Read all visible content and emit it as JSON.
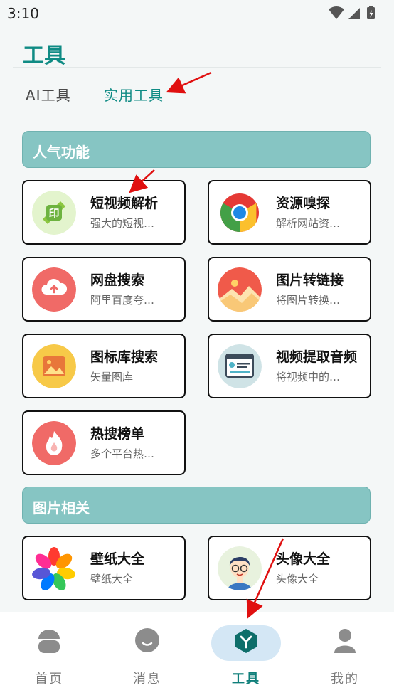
{
  "status": {
    "time": "3:10"
  },
  "header": {
    "title": "工具"
  },
  "tabs": [
    {
      "label": "AI工具"
    },
    {
      "label": "实用工具"
    }
  ],
  "sections": [
    {
      "title": "人气功能",
      "cards": [
        {
          "title": "短视频解析",
          "subtitle": "强大的短视…",
          "icon": "video-parse-icon"
        },
        {
          "title": "资源嗅探",
          "subtitle": "解析网站资…",
          "icon": "chrome-icon"
        },
        {
          "title": "网盘搜索",
          "subtitle": "阿里百度夸…",
          "icon": "cloud-upload-icon"
        },
        {
          "title": "图片转链接",
          "subtitle": "将图片转换…",
          "icon": "image-link-icon"
        },
        {
          "title": "图标库搜索",
          "subtitle": "矢量图库",
          "icon": "icon-library-icon"
        },
        {
          "title": "视频提取音频",
          "subtitle": "将视频中的…",
          "icon": "video-audio-icon"
        },
        {
          "title": "热搜榜单",
          "subtitle": "多个平台热…",
          "icon": "flame-icon"
        }
      ]
    },
    {
      "title": "图片相关",
      "cards": [
        {
          "title": "壁纸大全",
          "subtitle": "壁纸大全",
          "icon": "flower-icon"
        },
        {
          "title": "头像大全",
          "subtitle": "头像大全",
          "icon": "avatar-boy-icon"
        }
      ]
    }
  ],
  "bottom_nav": [
    {
      "label": "首页",
      "icon": "home-icon"
    },
    {
      "label": "消息",
      "icon": "message-icon"
    },
    {
      "label": "工具",
      "icon": "tools-icon",
      "active": true
    },
    {
      "label": "我的",
      "icon": "profile-icon"
    }
  ],
  "colors": {
    "accent": "#0f8b84",
    "section_bg": "#86c5c3",
    "annotation_arrow": "#e01010"
  }
}
